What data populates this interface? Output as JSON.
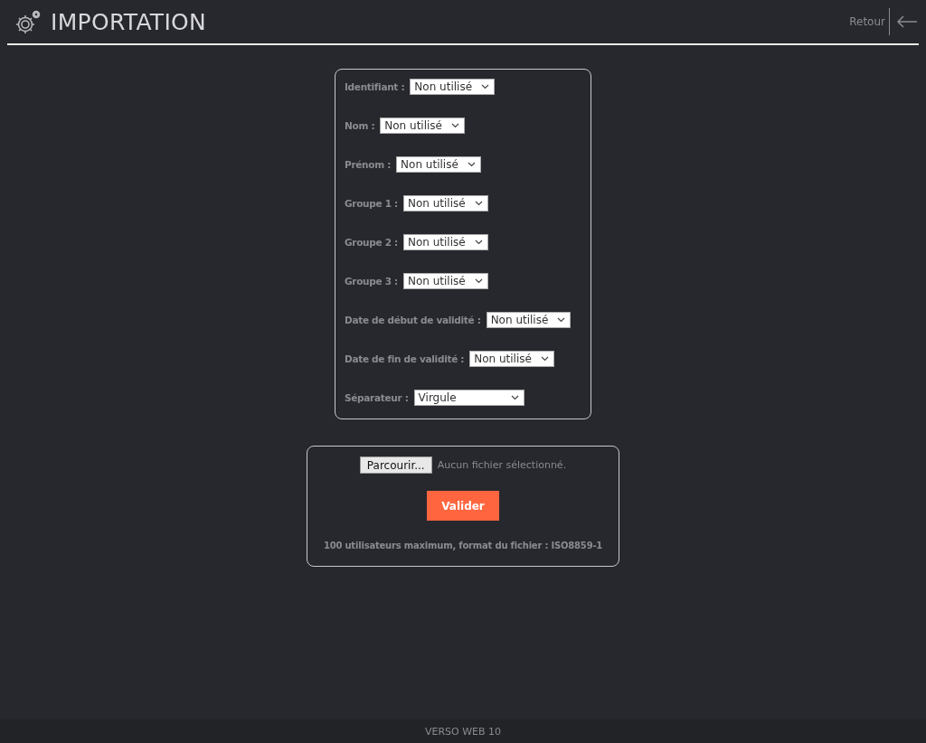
{
  "header": {
    "title": "IMPORTATION",
    "back_label": "Retour"
  },
  "mapping_fields": [
    {
      "label": "Identifiant :",
      "value": "Non utilisé"
    },
    {
      "label": "Nom :",
      "value": "Non utilisé"
    },
    {
      "label": "Prénom :",
      "value": "Non utilisé"
    },
    {
      "label": "Groupe 1 :",
      "value": "Non utilisé"
    },
    {
      "label": "Groupe 2 :",
      "value": "Non utilisé"
    },
    {
      "label": "Groupe 3 :",
      "value": "Non utilisé"
    },
    {
      "label": "Date de début de validité :",
      "value": "Non utilisé"
    },
    {
      "label": "Date de fin de validité :",
      "value": "Non utilisé"
    },
    {
      "label": "Séparateur :",
      "value": "Virgule"
    }
  ],
  "upload": {
    "browse_button": "Parcourir...",
    "file_status": "Aucun fichier sélectionné.",
    "submit_button": "Valider",
    "note": "100 utilisateurs maximum, format du fichier : ISO8859-1"
  },
  "footer": {
    "text": "VERSO WEB 10"
  }
}
